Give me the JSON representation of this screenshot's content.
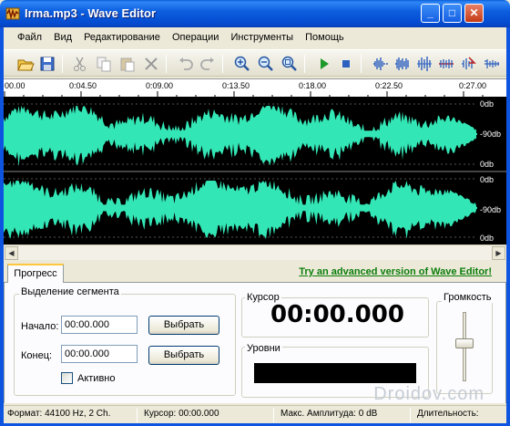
{
  "window": {
    "title": "Irma.mp3 - Wave Editor",
    "min_glyph": "_",
    "max_glyph": "□",
    "close_glyph": "✕"
  },
  "menu": [
    "Файл",
    "Вид",
    "Редактирование",
    "Операции",
    "Инструменты",
    "Помощь"
  ],
  "toolbar": {
    "icons": [
      "open-icon",
      "save-icon",
      "cut-icon",
      "copy-icon",
      "paste-icon",
      "delete-icon",
      "undo-icon",
      "redo-icon",
      "zoom-in-icon",
      "zoom-out-icon",
      "zoom-fit-icon",
      "play-icon",
      "stop-icon",
      "fade-icon",
      "normalize-icon",
      "amplify-icon",
      "echo-icon",
      "reverse-icon",
      "silence-icon"
    ]
  },
  "ruler": {
    "ticks": [
      "00.00",
      "0:04.50",
      "0:09.00",
      "0:13.50",
      "0:18.00",
      "0:22.50",
      "0:27.00"
    ]
  },
  "wave": {
    "color": "#33e6b5",
    "channels": [
      {
        "labels": [
          "0db",
          "-90db",
          "0db"
        ]
      },
      {
        "labels": [
          "0db",
          "-90db",
          "0db"
        ]
      }
    ]
  },
  "tabs": {
    "active": "Прогресс",
    "promo_link": "Try an advanced version of Wave Editor!"
  },
  "selection": {
    "title": "Выделение сегмента",
    "start_label": "Начало:",
    "start_value": "00:00.000",
    "end_label": "Конец:",
    "end_value": "00:00.000",
    "select_button": "Выбрать",
    "active_label": "Активно"
  },
  "cursor": {
    "title": "Курсор",
    "value": "00:00.000"
  },
  "levels": {
    "title": "Уровни"
  },
  "volume": {
    "title": "Громкость",
    "level": 0.55
  },
  "status": {
    "format": "Формат: 44100 Hz, 2 Ch.",
    "cursor": "Курсор: 00:00.000",
    "amplitude": "Макс. Амплитуда: 0 dB",
    "duration": "Длительность:"
  },
  "watermark": "Droidov.com"
}
